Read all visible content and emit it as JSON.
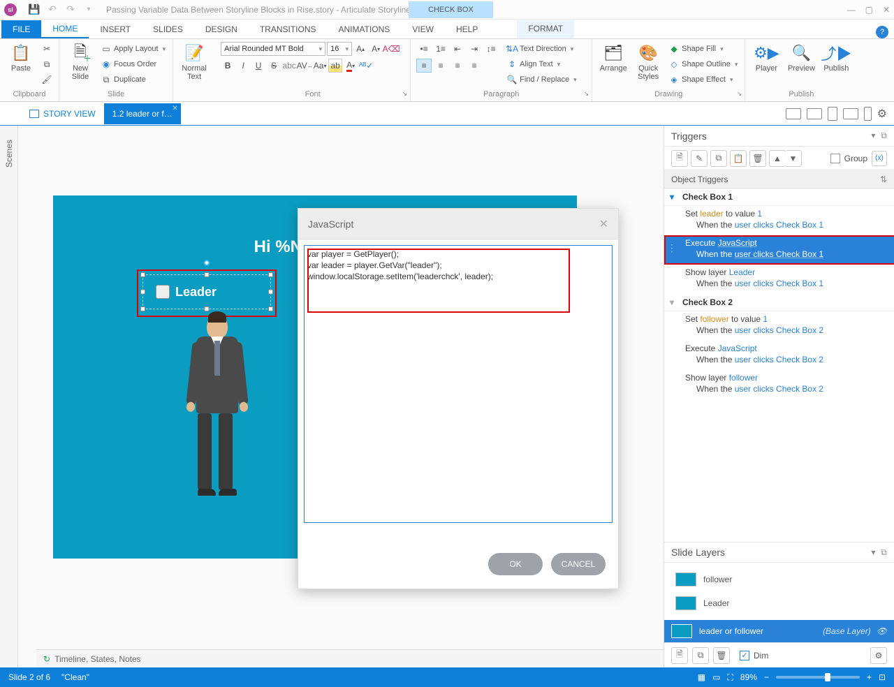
{
  "titlebar": {
    "document_title": "Passing Variable Data Between Storyline Blocks in Rise.story - Articulate Storyline",
    "contextual_tab": "CHECK BOX"
  },
  "menu": {
    "file": "FILE",
    "home": "HOME",
    "insert": "INSERT",
    "slides": "SLIDES",
    "design": "DESIGN",
    "transitions": "TRANSITIONS",
    "animations": "ANIMATIONS",
    "view": "VIEW",
    "help": "HELP",
    "format": "FORMAT"
  },
  "ribbon": {
    "clipboard": {
      "paste": "Paste",
      "cut": "Cut",
      "copy": "Copy",
      "format_painter": "Format Painter",
      "label": "Clipboard"
    },
    "slide": {
      "new_slide": "New\nSlide",
      "apply_layout": "Apply Layout",
      "focus_order": "Focus Order",
      "duplicate": "Duplicate",
      "label": "Slide"
    },
    "text": {
      "normal_text": "Normal\nText",
      "label": ""
    },
    "font": {
      "font_name": "Arial Rounded MT Bold",
      "font_size": "16",
      "label": "Font"
    },
    "paragraph": {
      "text_direction": "Text Direction",
      "align_text": "Align Text",
      "find_replace": "Find / Replace",
      "label": "Paragraph"
    },
    "drawing": {
      "arrange": "Arrange",
      "quick_styles": "Quick\nStyles",
      "shape_fill": "Shape Fill",
      "shape_outline": "Shape Outline",
      "shape_effect": "Shape Effect",
      "label": "Drawing"
    },
    "publish": {
      "player": "Player",
      "preview": "Preview",
      "publish": "Publish",
      "label": "Publish"
    }
  },
  "subbar": {
    "story_view": "STORY VIEW",
    "active_tab": "1.2 leader or f…"
  },
  "slide": {
    "title_text": "Hi %Name%, ar",
    "checkbox_label": "Leader"
  },
  "dialog": {
    "title": "JavaScript",
    "code_line1": "var player = GetPlayer();",
    "code_line2": "var leader = player.GetVar(\"leader\");",
    "code_line3": "window.localStorage.setItem('leaderchck', leader);",
    "ok": "OK",
    "cancel": "CANCEL"
  },
  "triggers": {
    "title": "Triggers",
    "group_label": "Group",
    "object_header": "Object Triggers",
    "checkbox1": "Check Box 1",
    "checkbox2": "Check Box 2",
    "t1_action": "Set ",
    "t1_var": "leader",
    "t1_mid": " to value ",
    "t1_val": "1",
    "t1_when_pre": "When the ",
    "t1_when_ev": "user clicks",
    "t1_when_obj": " Check Box 1",
    "t2_action": "Execute ",
    "t2_link": "JavaScript",
    "t2_when_pre": "When the ",
    "t2_when_ev": "user clicks",
    "t2_when_obj": " Check Box 1",
    "t3_action": "Show layer ",
    "t3_link": "Leader",
    "t3_when_pre": "When the ",
    "t3_when_ev": "user clicks",
    "t3_when_obj": " Check Box 1",
    "t4_action": "Set ",
    "t4_var": "follower",
    "t4_mid": " to value ",
    "t4_val": "1",
    "t4_when_pre": "When the ",
    "t4_when_ev": "user clicks",
    "t4_when_obj": " Check Box 2",
    "t5_action": "Execute ",
    "t5_link": "JavaScript",
    "t5_when_pre": "When the ",
    "t5_when_ev": "user clicks",
    "t5_when_obj": " Check Box 2",
    "t6_action": "Show layer ",
    "t6_link": "follower",
    "t6_when_pre": "When the ",
    "t6_when_ev": "user clicks",
    "t6_when_obj": " Check Box 2"
  },
  "slide_layers": {
    "title": "Slide Layers",
    "layer_follower": "follower",
    "layer_leader": "Leader",
    "base_name": "leader or follower",
    "base_label": "(Base Layer)",
    "dim": "Dim"
  },
  "timeline": {
    "label": "Timeline, States, Notes"
  },
  "status": {
    "slide_info": "Slide 2 of 6",
    "layout": "\"Clean\"",
    "zoom": "89%"
  },
  "scenes_label": "Scenes"
}
